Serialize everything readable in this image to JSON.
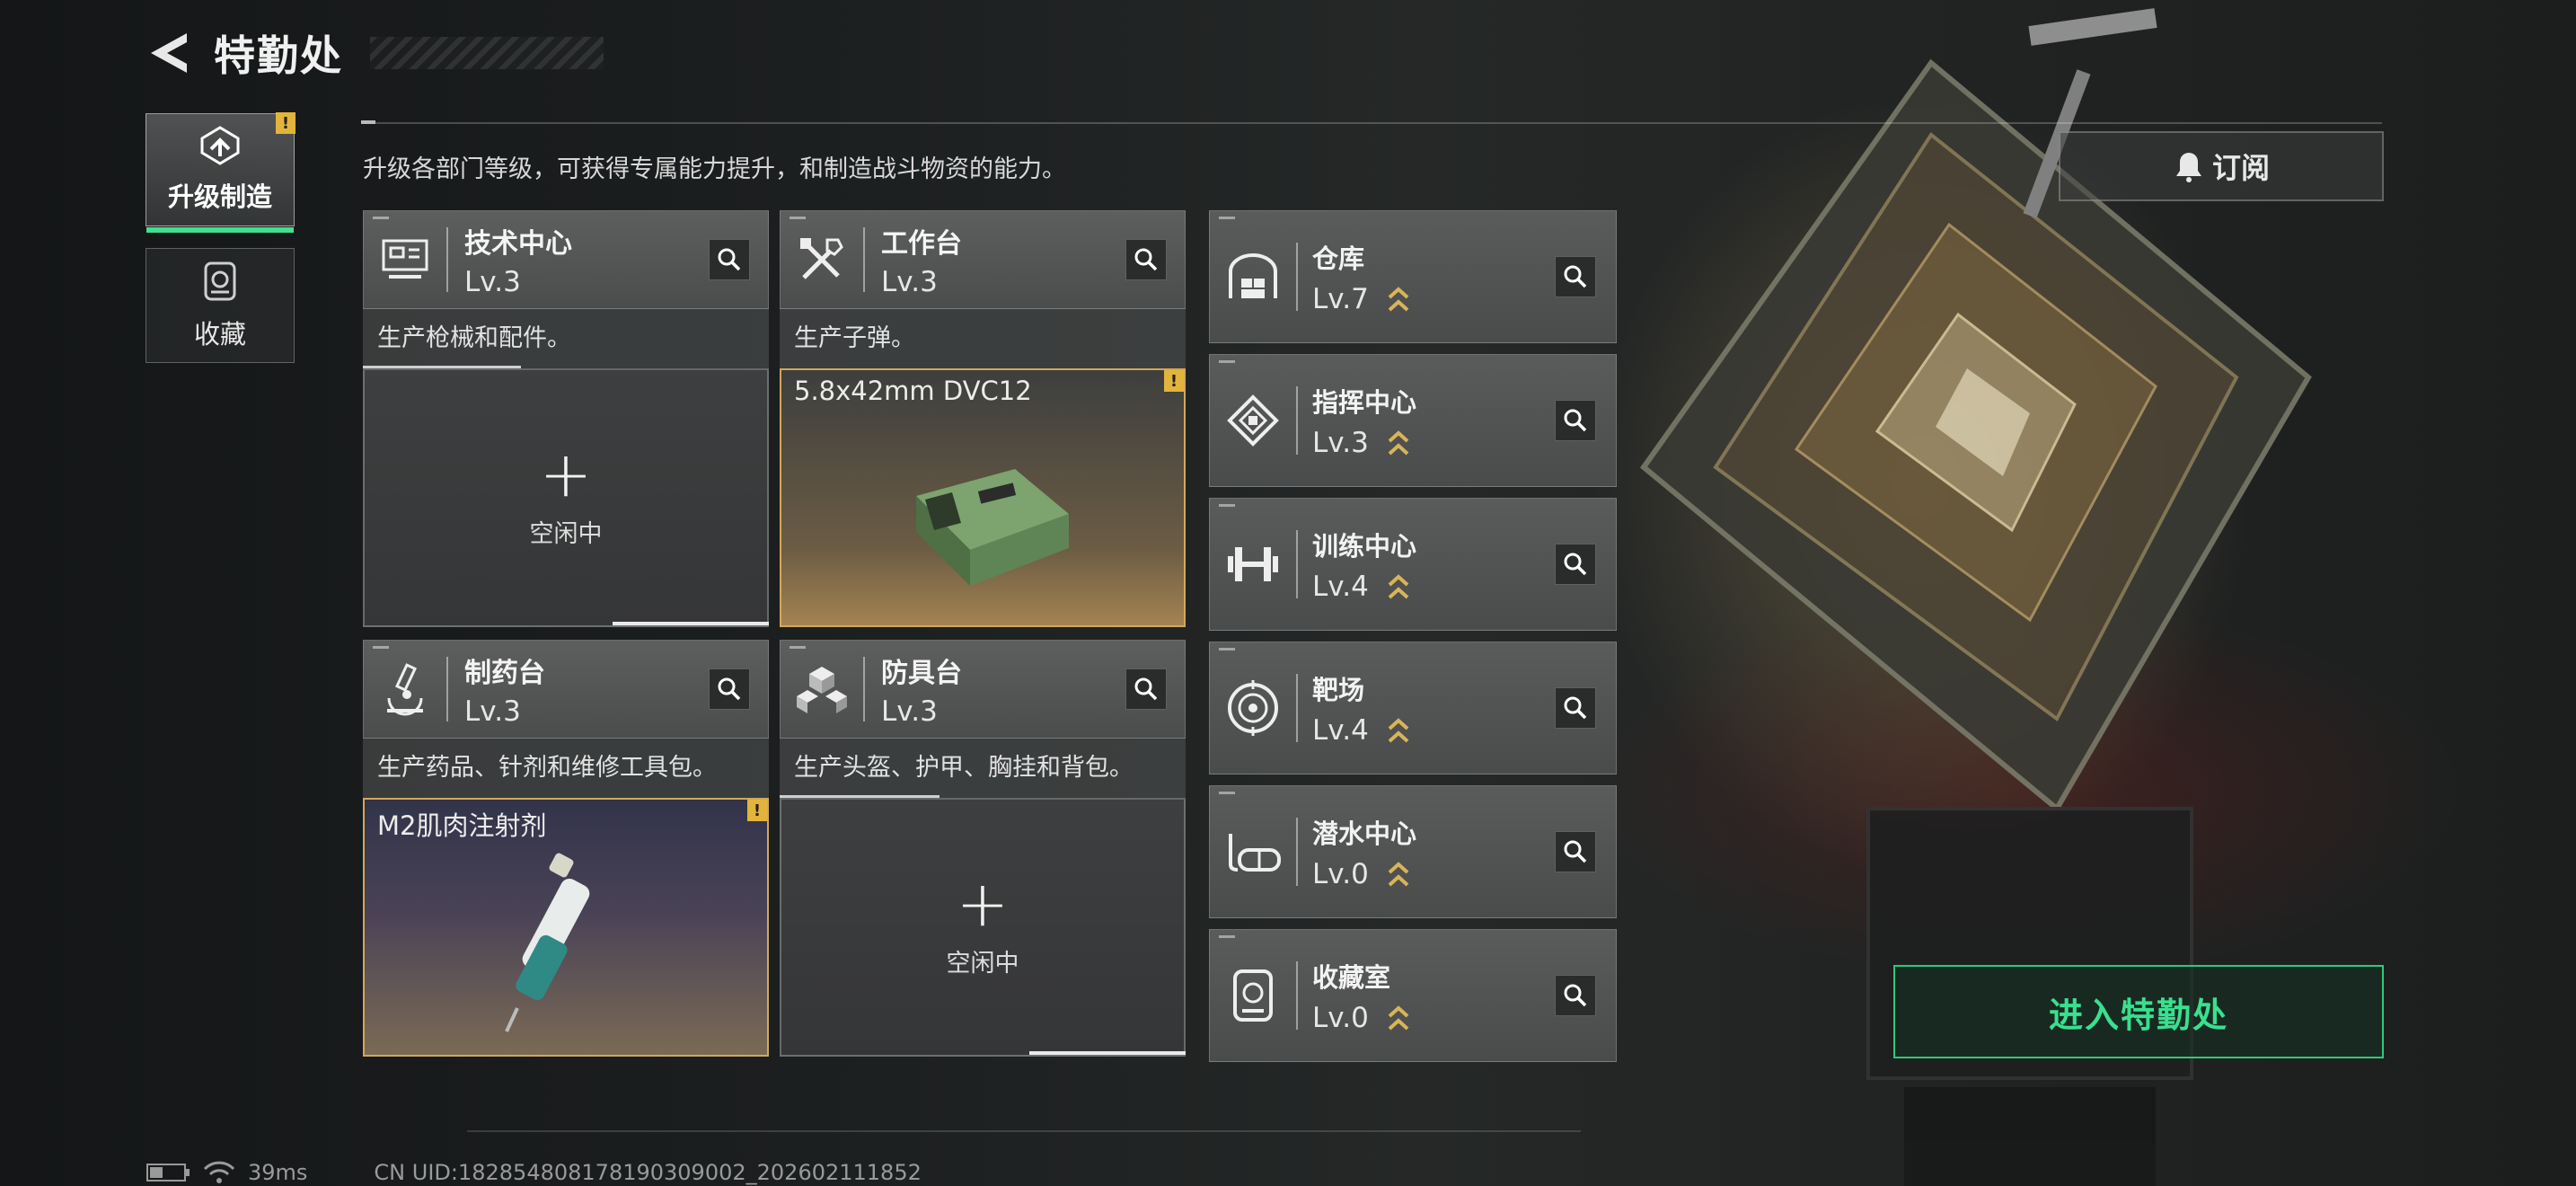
{
  "header": {
    "title": "特勤处"
  },
  "nav": {
    "tabs": [
      {
        "label": "升级制造",
        "active": true,
        "icon": "upgrade-icon",
        "warning": "!"
      },
      {
        "label": "收藏",
        "active": false,
        "icon": "collection-icon"
      }
    ]
  },
  "description": "升级各部门等级，可获得专属能力提升，和制造战斗物资的能力。",
  "departments": [
    {
      "name": "技术中心",
      "level": "Lv.3",
      "icon": "monitor-icon",
      "desc": "生产枪械和配件。",
      "slot": {
        "status": "idle",
        "plus": "+",
        "idle_text": "空闲中"
      }
    },
    {
      "name": "工作台",
      "level": "Lv.3",
      "icon": "tools-icon",
      "desc": "生产子弹。",
      "slot": {
        "status": "producing",
        "item": "5.8x42mm DVC12",
        "warning": "!"
      }
    },
    {
      "name": "制药台",
      "level": "Lv.3",
      "icon": "microscope-icon",
      "desc": "生产药品、针剂和维修工具包。",
      "slot": {
        "status": "producing",
        "item": "M2肌肉注射剂",
        "warning": "!"
      }
    },
    {
      "name": "防具台",
      "level": "Lv.3",
      "icon": "armor-blocks-icon",
      "desc": "生产头盔、护甲、胸挂和背包。",
      "slot": {
        "status": "idle",
        "plus": "+",
        "idle_text": "空闲中"
      }
    }
  ],
  "facilities": [
    {
      "name": "仓库",
      "level": "Lv.7",
      "icon": "warehouse-icon"
    },
    {
      "name": "指挥中心",
      "level": "Lv.3",
      "icon": "command-icon"
    },
    {
      "name": "训练中心",
      "level": "Lv.4",
      "icon": "dumbbell-icon"
    },
    {
      "name": "靶场",
      "level": "Lv.4",
      "icon": "target-icon"
    },
    {
      "name": "潜水中心",
      "level": "Lv.0",
      "icon": "diving-mask-icon"
    },
    {
      "name": "收藏室",
      "level": "Lv.0",
      "icon": "collection-room-icon"
    }
  ],
  "buttons": {
    "subscribe": "订阅",
    "enter": "进入特勤处"
  },
  "footer": {
    "ping": "39ms",
    "uid": "CN UID:182854808178190309002_202602111852"
  },
  "colors": {
    "accent_green": "#38e08f",
    "warning_yellow": "#e3b43b",
    "upgrade_gold": "#d8b45a",
    "slot_border_gold": "#d2a85a"
  }
}
